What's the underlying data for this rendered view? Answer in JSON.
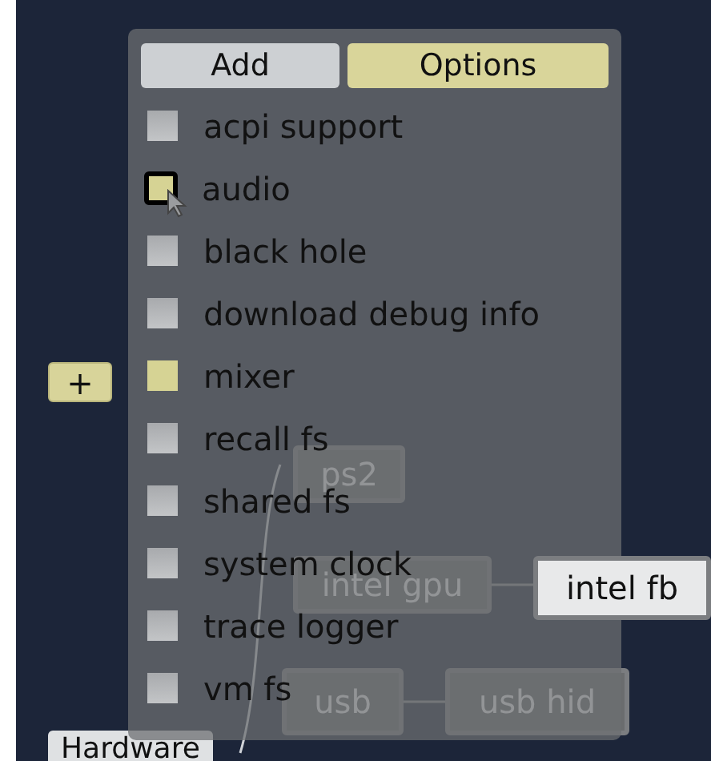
{
  "canvas": {
    "add_button": "+",
    "nodes": [
      {
        "label": "ps2"
      },
      {
        "label": "intel gpu"
      },
      {
        "label": "intel fb"
      },
      {
        "label": "usb"
      },
      {
        "label": "usb hid"
      }
    ],
    "group_label": "Hardware"
  },
  "panel": {
    "tabs": [
      {
        "label": "Add",
        "selected": false
      },
      {
        "label": "Options",
        "selected": true
      }
    ],
    "options": [
      {
        "label": "acpi support",
        "checked": false,
        "hovered": false
      },
      {
        "label": "audio",
        "checked": true,
        "hovered": true
      },
      {
        "label": "black hole",
        "checked": false,
        "hovered": false
      },
      {
        "label": "download debug info",
        "checked": false,
        "hovered": false
      },
      {
        "label": "mixer",
        "checked": true,
        "hovered": false
      },
      {
        "label": "recall fs",
        "checked": false,
        "hovered": false
      },
      {
        "label": "shared fs",
        "checked": false,
        "hovered": false
      },
      {
        "label": "system clock",
        "checked": false,
        "hovered": false
      },
      {
        "label": "trace logger",
        "checked": false,
        "hovered": false
      },
      {
        "label": "vm fs",
        "checked": false,
        "hovered": false
      }
    ]
  }
}
